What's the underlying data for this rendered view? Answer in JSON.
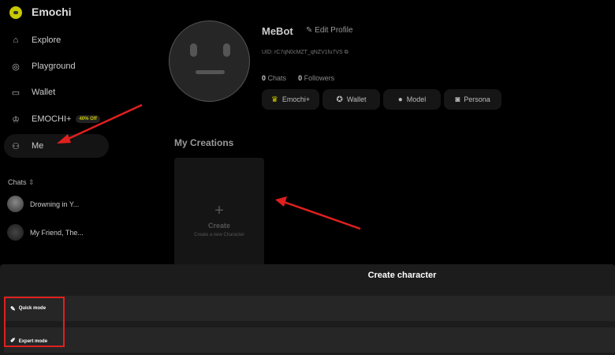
{
  "app": {
    "brand": "Emochi"
  },
  "sidebar": {
    "items": [
      {
        "label": "Explore",
        "icon": "home-icon"
      },
      {
        "label": "Playground",
        "icon": "planet-icon"
      },
      {
        "label": "Wallet",
        "icon": "wallet-icon"
      },
      {
        "label": "EMOCHI+",
        "icon": "crown-icon",
        "badge": "40% Off"
      },
      {
        "label": "Me",
        "icon": "user-icon",
        "active": true
      }
    ],
    "chats_label": "Chats",
    "chats": [
      {
        "title": "Drowning in Y..."
      },
      {
        "title": "My Friend, The..."
      }
    ]
  },
  "profile": {
    "name": "MeBot",
    "edit_label": "Edit Profile",
    "uid": "UID: rC7qN0cMZT_qNZV1fu7VS",
    "chats_count": "0",
    "chats_label": "Chats",
    "followers_count": "0",
    "followers_label": "Followers",
    "buttons": [
      {
        "label": "Emochi+"
      },
      {
        "label": "Wallet"
      },
      {
        "label": "Model"
      },
      {
        "label": "Persona"
      }
    ]
  },
  "creations": {
    "title": "My Creations",
    "create_label": "Create",
    "create_sub": "Create a new Character"
  },
  "sheet": {
    "title": "Create character",
    "options": [
      {
        "label": "Quick mode"
      },
      {
        "label": "Expert mode"
      }
    ]
  },
  "colors": {
    "accent": "#c8c800",
    "annotation": "#e0201f"
  }
}
